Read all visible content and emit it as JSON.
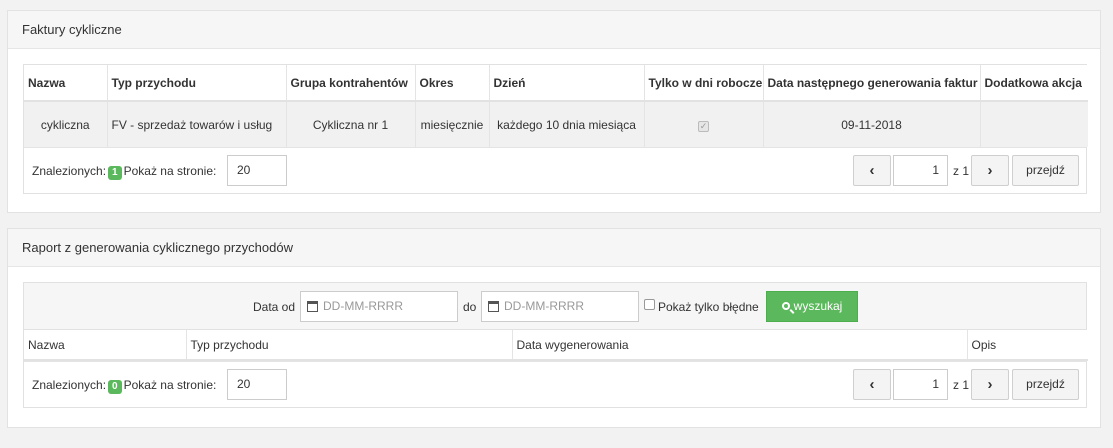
{
  "section1": {
    "title": "Faktury cykliczne",
    "columns": [
      "Nazwa",
      "Typ przychodu",
      "Grupa kontrahentów",
      "Okres",
      "Dzień",
      "Tylko w dni robocze",
      "Data następnego generowania faktur",
      "Dodatkowa akcja"
    ],
    "row": {
      "nazwa": "cykliczna",
      "typ": "FV - sprzedaż towarów i usług",
      "grupa": "Cykliczna nr 1",
      "okres": "miesięcznie",
      "dzien": "każdego 10 dnia miesiąca",
      "dni_robocze_checked": true,
      "data_next": "09-11-2018",
      "akcja": ""
    },
    "footer": {
      "found_label": "Znalezionych:",
      "found_count": "1",
      "per_page_label": "Pokaż na stronie:",
      "per_page_value": "20",
      "page": "1",
      "of_label": "z 1",
      "go_label": "przejdź"
    }
  },
  "section2": {
    "title": "Raport z generowania cyklicznego przychodów",
    "date_from_label": "Data od",
    "date_from_placeholder": "DD-MM-RRRR",
    "date_to_label": "do",
    "date_to_placeholder": "DD-MM-RRRR",
    "only_errors_label": "Pokaż tylko błędne",
    "search_label": "wyszukaj",
    "columns": [
      "Nazwa",
      "Typ przychodu",
      "Data wygenerowania",
      "Opis"
    ],
    "footer": {
      "found_label": "Znalezionych:",
      "found_count": "0",
      "per_page_label": "Pokaż na stronie:",
      "per_page_value": "20",
      "page": "1",
      "of_label": "z 1",
      "go_label": "przejdź"
    }
  }
}
